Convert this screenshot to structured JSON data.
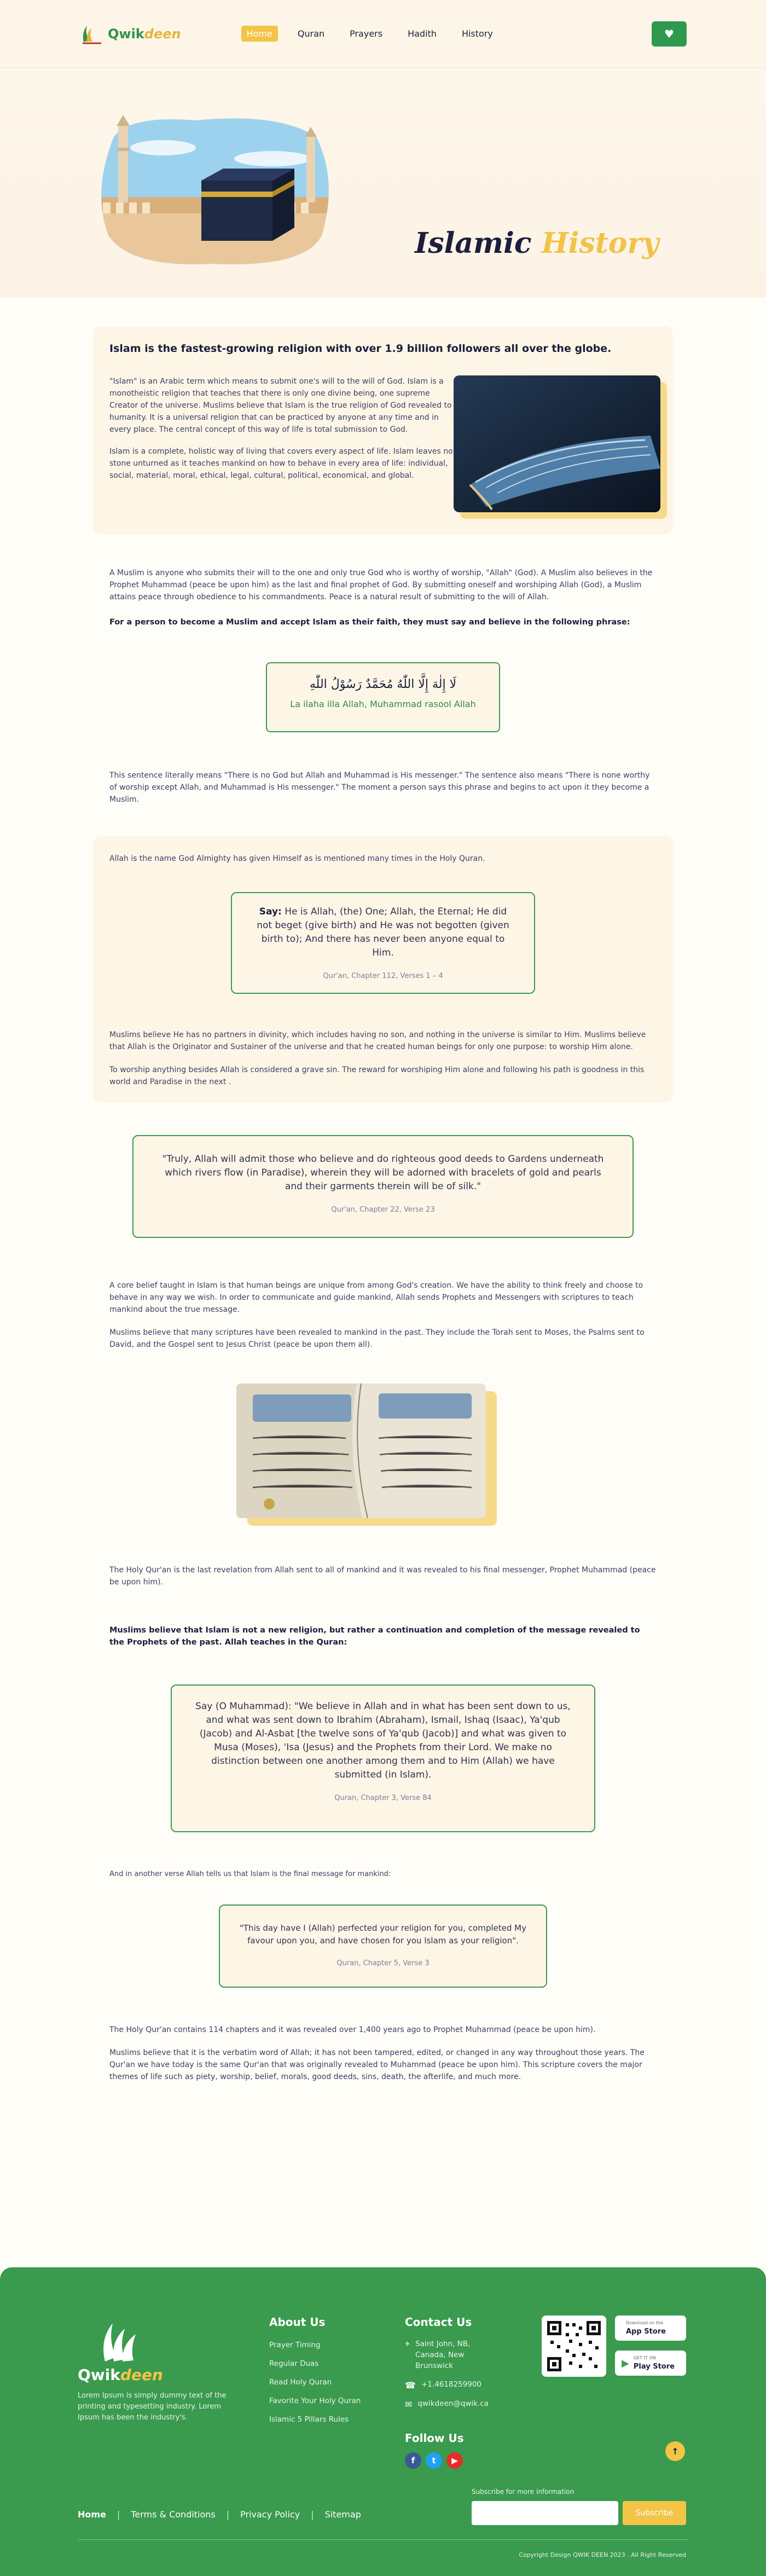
{
  "header": {
    "logo_prefix": "Qwik",
    "logo_suffix": "deen",
    "nav": [
      "Home",
      "Quran",
      "Prayers",
      "Hadith",
      "History"
    ],
    "active_nav": "Home"
  },
  "hero": {
    "title_word1": "Islamic",
    "title_word2": "History"
  },
  "intro": {
    "heading": "Islam is the fastest-growing religion with over 1.9 billion followers all over the globe.",
    "p1": "\"Islam\" is an Arabic term which means to submit one's will to the will of God. Islam is a monotheistic religion that teaches that there is only one divine being, one supreme Creator of the universe. Muslims believe that Islam is the true religion of God revealed to humanity. It is a universal religion that can be practiced by anyone at any time and in every place. The central concept of this way of life is total submission to God.",
    "p2": "Islam is a complete, holistic way of living that covers every aspect of life. Islam leaves no stone unturned as it teaches mankind on how to behave in every area of life: individual, social, material, moral, ethical, legal, cultural, political, economical, and global."
  },
  "muslim_para": "A Muslim is anyone who submits their will to the one and only true God who is worthy of worship, \"Allah\" (God). A Muslim also believes in the Prophet Muhammad (peace be upon him) as the last and final prophet of God. By submitting oneself and worshiping Allah (God), a Muslim attains peace through obedience to his commandments. Peace is a natural result of submitting to the will of Allah.",
  "phrase_intro": "For a person to become a Muslim and accept Islam as their faith, they must say and believe in the following phrase:",
  "shahada": {
    "arabic": "لَا إِلٰهَ إِلَّا اللّٰهُ مُحَمَّدٌ رَسُوْلُ اللّٰهِ",
    "translit": "La ilaha illa Allah, Muhammad rasool Allah"
  },
  "sentence_para": "This sentence literally means \"There is no God but Allah and Muhammad is His messenger.\" The sentence also means \"There is none worthy of worship except Allah, and Muhammad is His messenger.\" The moment a person says this phrase and begins to act upon it they become a Muslim.",
  "allah": {
    "intro": "Allah is the name God Almighty has given Himself as is mentioned many times in the Holy Quran.",
    "quote_lead": "Say:",
    "quote": " He is Allah, (the) One; Allah, the Eternal; He did not beget (give birth) and He was not begotten (given birth to); And there has never been anyone equal to Him.",
    "ref": "Qur'an, Chapter 112, Verses 1 – 4",
    "p1": "Muslims believe He has no partners in divinity, which includes having no son, and nothing in the universe is similar to Him. Muslims believe that Allah is the Originator and Sustainer of the universe and that he created human beings for only one purpose: to worship Him alone.",
    "p2": "To worship anything besides Allah is considered a grave sin. The reward for worshiping Him alone and following his path is goodness in this world and Paradise in the next ."
  },
  "quote2": {
    "text": "\"Truly, Allah will admit those who believe and do righteous good deeds to Gardens underneath which rivers flow (in Paradise), wherein they will be adorned with bracelets of gold and pearls and their garments therein will be of silk.\"",
    "ref": "Qur'an, Chapter 22, Verse 23"
  },
  "belief": {
    "p1": "A core belief taught in Islam is that human beings are unique from among God's creation. We have the ability to think freely and choose to behave in any way we wish. In order to communicate and guide mankind, Allah sends Prophets and Messengers with scriptures to teach mankind about the true message.",
    "p2": "Muslims believe that many scriptures have been revealed to mankind in the past. They include the Torah sent to Moses, the Psalms sent to David, and the Gospel sent to Jesus Christ (peace be upon them all).",
    "p3": "The Holy Qur'an is the last revelation from Allah sent to all of mankind and it was revealed to his final messenger, Prophet Muhammad (peace be upon him)."
  },
  "continuation": "Muslims believe that Islam is not a new religion, but rather a continuation and completion of the message revealed to the Prophets of the past. Allah teaches in the Quran:",
  "quote3": {
    "text": "Say (O Muhammad): \"We believe in Allah and in what has been sent down to us, and what was sent down to Ibrahim (Abraham), Ismail, Ishaq (Isaac), Ya'qub (Jacob) and Al-Asbat [the twelve sons of Ya'qub (Jacob)] and what was given to Musa (Moses), 'Isa (Jesus) and the Prophets from their Lord. We make no distinction between one another among them and to Him (Allah) we have submitted (in Islam).",
    "ref": "Quran, Chapter 3, Verse 84"
  },
  "another_verse": "And in another verse Allah tells us that Islam is the final message for mankind:",
  "quote4": {
    "text": "\"This day have I (Allah) perfected your religion for you, completed My favour upon you, and have chosen for you Islam as your religion\".",
    "ref": "Quran, Chapter 5, Verse 3"
  },
  "closing": {
    "p1": "The Holy Qur'an contains 114 chapters and it was revealed over 1,400 years ago to Prophet Muhammad (peace be upon him).",
    "p2": "Muslims believe that it is the verbatim word of Allah; it has not been tampered, edited, or changed in any way throughout those years. The Qur'an we have today is the same Qur'an that was originally revealed to Muhammad (peace be upon him). This scripture covers the major themes of life such as piety, worship, belief, morals, good deeds, sins, death, the afterlife, and much more."
  },
  "footer": {
    "logo_prefix": "Qwik",
    "logo_suffix": "deen",
    "about_text": "Lorem Ipsum is simply dummy text of the printing and typesetting industry. Lorem Ipsum has been the industry's.",
    "about_title": "About Us",
    "about_links": [
      "Prayer Timing",
      "Regular Duas",
      "Read Holy Quran",
      "Favorite Your Holy Quran",
      "Islamic 5 Pillars Rules"
    ],
    "contact_title": "Contact Us",
    "address": "Saint John, NB, Canada, New Brunswick",
    "phone": "+1.4618259900",
    "email": "qwikdeen@qwik.ca",
    "follow_title": "Follow Us",
    "app_store_small": "Download on the",
    "app_store": "App Store",
    "play_store_small": "GET IT ON",
    "play_store": "Play Store",
    "bottom_links": [
      "Home",
      "Terms & Conditions",
      "Privacy Policy",
      "Sitemap"
    ],
    "subscribe_label": "Subscribe for more information",
    "subscribe_button": "Subscribe",
    "copyright": "Copyright Design QWIK DEEN 2023 . All Right Reserved"
  },
  "colors": {
    "green": "#3a9a4e",
    "gold": "#f0c34a",
    "navy": "#1b1e3c",
    "cream": "#fdf6e6"
  }
}
